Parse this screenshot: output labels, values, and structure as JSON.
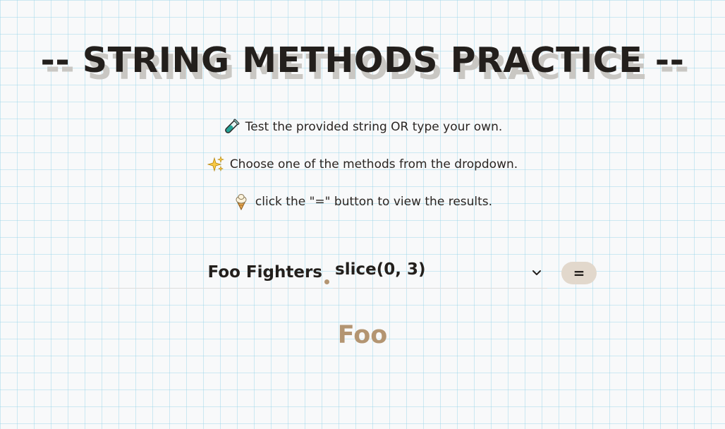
{
  "header": {
    "title": "-- STRING METHODS PRACTICE --"
  },
  "instructions": [
    {
      "icon": "test-tube-icon",
      "text": "Test the provided string OR type your own."
    },
    {
      "icon": "sparkles-icon",
      "text": "Choose one of the methods from the dropdown."
    },
    {
      "icon": "ice-cream-icon",
      "text": "click the \"=\" button to view the results."
    }
  ],
  "form": {
    "string_value": "Foo Fighters",
    "method_selected": "slice(0, 3)",
    "equals_label": "="
  },
  "result": {
    "text": "Foo"
  },
  "colors": {
    "accent": "#b39572",
    "button_bg": "#e2d8cc",
    "text": "#231f1c"
  }
}
